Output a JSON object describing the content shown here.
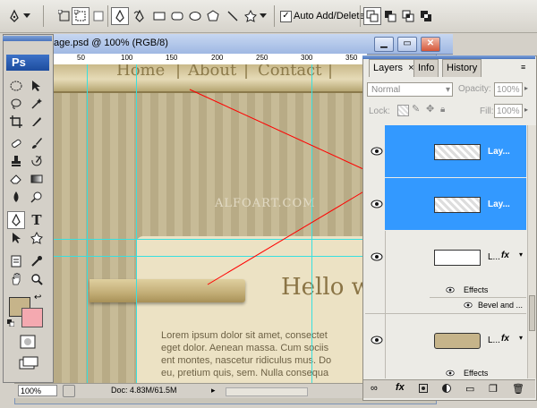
{
  "options_bar": {
    "auto_add_delete_label": "Auto Add/Delete",
    "auto_add_delete_checked": true
  },
  "document": {
    "title": "age.psd @ 100% (RGB/8)",
    "ruler_labels": [
      "50",
      "100",
      "150",
      "200",
      "250",
      "300",
      "350"
    ],
    "nav_items": [
      "Home",
      "|",
      "About",
      "|",
      "Contact",
      "|"
    ],
    "watermark": "ALFOART.COM",
    "heading": "Hello w",
    "body_lines": [
      "Lorem ipsum dolor sit amet, consectet",
      "eget dolor. Aenean massa. Cum sociis",
      "ent montes, nascetur ridiculus mus. Do",
      "eu, pretium quis, sem. Nulla consequa"
    ]
  },
  "status_bar": {
    "zoom": "100%",
    "doc_size": "Doc: 4.83M/61.5M"
  },
  "toolbox": {
    "badge": "Ps"
  },
  "layers_panel": {
    "tabs": [
      {
        "label": "Layers",
        "active": true
      },
      {
        "label": "Info",
        "active": false
      },
      {
        "label": "History",
        "active": false
      }
    ],
    "blend_mode": "Normal",
    "opacity_label": "Opacity:",
    "opacity_value": "100%",
    "lock_label": "Lock:",
    "fill_label": "Fill:",
    "fill_value": "100%",
    "layers": [
      {
        "name": "Lay...",
        "selected": true,
        "fx": false
      },
      {
        "name": "Lay...",
        "selected": true,
        "fx": false
      },
      {
        "name": "L...",
        "selected": false,
        "fx": true,
        "effects_label": "Effects",
        "sub_effect": "Bevel and ..."
      },
      {
        "name": "L...",
        "selected": false,
        "fx": true,
        "effects_label": "Effects"
      }
    ],
    "fx_symbol": "fx"
  },
  "colors": {
    "selection_blue": "#3399ff",
    "foreground_swatch": "#c6b48a",
    "background_swatch": "#f4a9b0",
    "guide": "#38e0df",
    "path_line": "#ff0000"
  }
}
